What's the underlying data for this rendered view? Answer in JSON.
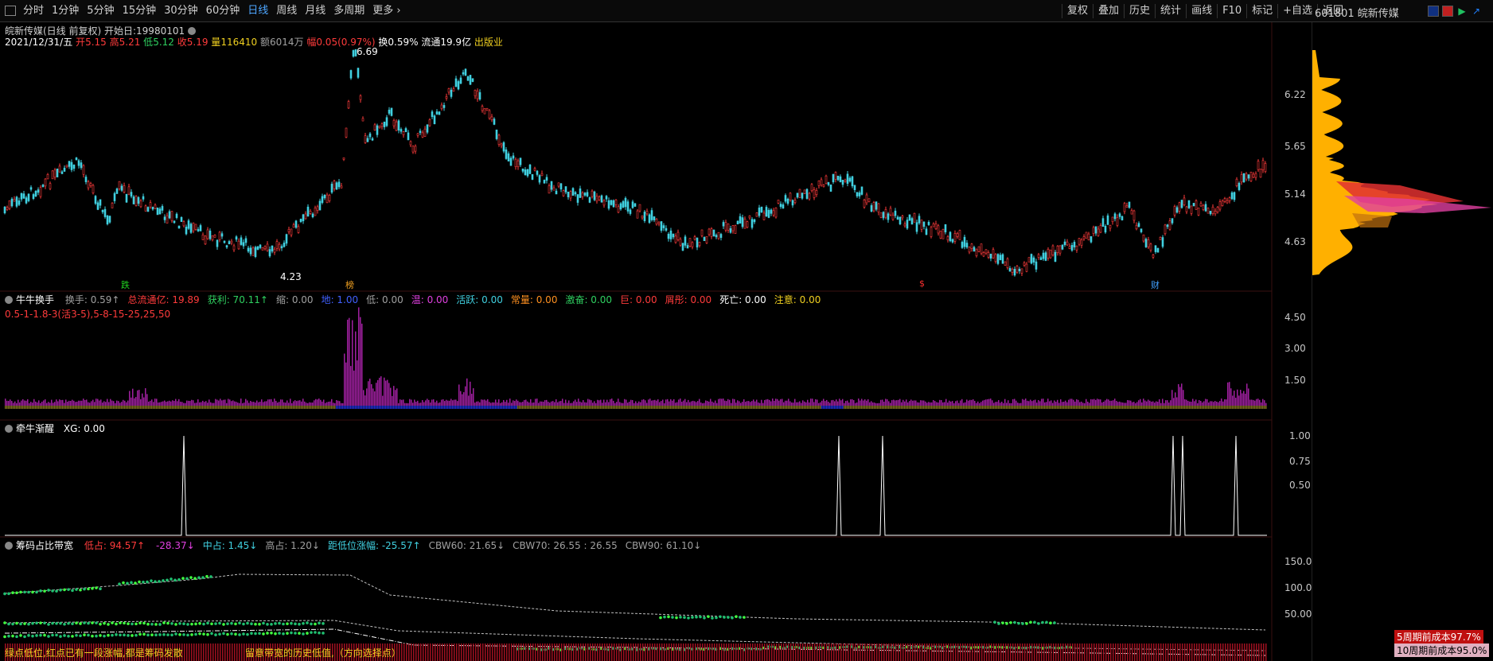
{
  "toolbar": {
    "periods": [
      "分时",
      "1分钟",
      "5分钟",
      "15分钟",
      "30分钟",
      "60分钟",
      "日线",
      "周线",
      "月线",
      "多周期",
      "更多"
    ],
    "active_period": "日线",
    "right_buttons": [
      "复权",
      "叠加",
      "历史",
      "统计",
      "画线",
      "F10",
      "标记",
      "+自选",
      "返回"
    ]
  },
  "symbol": {
    "code": "601801",
    "name": "皖新传媒"
  },
  "main_chart": {
    "title": "皖新传媒(日线 前复权) 开始日:19980101",
    "date": "2021/12/31/五",
    "open_label": "开",
    "open": "5.15",
    "high_label": "高",
    "high": "5.21",
    "low_label": "低",
    "low": "5.12",
    "close_label": "收",
    "close": "5.19",
    "vol_label": "量",
    "vol": "116410",
    "amount_label": "额",
    "amount": "6014万",
    "change_label": "幅",
    "change": "0.05(0.97%)",
    "turnover": "换0.59%",
    "float_cap": "流通19.9亿",
    "industry": "出版业",
    "y_ticks": [
      "6.22",
      "5.65",
      "5.14",
      "4.63"
    ],
    "high_marker": "6.69",
    "low_marker": "4.23",
    "markers": [
      "跌",
      "榜",
      "$",
      "财"
    ]
  },
  "panel2": {
    "title": "牛牛换手",
    "items": [
      {
        "label": "换手:",
        "value": "0.59",
        "arrow": "↑",
        "color": "gray"
      },
      {
        "label": "总流通亿:",
        "value": "19.89",
        "color": "red"
      },
      {
        "label": "获利:",
        "value": "70.11",
        "arrow": "↑",
        "color": "green"
      },
      {
        "label": "缩:",
        "value": "0.00",
        "color": "gray"
      },
      {
        "label": "地:",
        "value": "1.00",
        "color": "blue"
      },
      {
        "label": "低:",
        "value": "0.00",
        "color": "gray"
      },
      {
        "label": "温:",
        "value": "0.00",
        "color": "magenta"
      },
      {
        "label": "活跃:",
        "value": "0.00",
        "color": "cyan"
      },
      {
        "label": "常量:",
        "value": "0.00",
        "color": "orange"
      },
      {
        "label": "激奋:",
        "value": "0.00",
        "color": "green"
      },
      {
        "label": "巨:",
        "value": "0.00",
        "color": "red"
      },
      {
        "label": "屑彤:",
        "value": "0.00",
        "color": "red"
      },
      {
        "label": "死亡:",
        "value": "0.00",
        "color": "white"
      },
      {
        "label": "注意:",
        "value": "0.00",
        "color": "yellow"
      }
    ],
    "subtitle": "0.5-1-1.8-3(活3-5),5-8-15-25,25,50",
    "y_ticks": [
      "4.50",
      "3.00",
      "1.50"
    ]
  },
  "panel3": {
    "title": "牵牛渐醒",
    "xg": "XG: 0.00",
    "y_ticks": [
      "1.00",
      "0.75",
      "0.50"
    ]
  },
  "panel4": {
    "title": "筹码占比带宽",
    "items": [
      {
        "label": "低占:",
        "value": "94.57",
        "arrow": "↑",
        "color": "red"
      },
      {
        "label": "",
        "value": "-28.37",
        "arrow": "↓",
        "color": "magenta"
      },
      {
        "label": "中占:",
        "value": "1.45",
        "arrow": "↓",
        "color": "cyan"
      },
      {
        "label": "高占:",
        "value": "1.20",
        "arrow": "↓",
        "color": "gray"
      },
      {
        "label": "距低位涨幅:",
        "value": "-25.57",
        "arrow": "↑",
        "color": "cyan"
      },
      {
        "label": "CBW60:",
        "value": "21.65",
        "arrow": "↓",
        "color": "gray"
      },
      {
        "label": "CBW70:",
        "value": "26.55 : 26.55",
        "color": "gray"
      },
      {
        "label": "CBW90:",
        "value": "61.10",
        "arrow": "↓",
        "color": "gray"
      }
    ],
    "y_ticks": [
      "150.0",
      "100.0",
      "50.00"
    ],
    "bottom_text_left": "绿点低位,红点已有一段涨幅,都是筹码发散",
    "bottom_text_right": "留意带宽的历史低值,（方向选择点）"
  },
  "chip_panel": {
    "label_5": "5周期前成本97.7%",
    "label_10": "10周期前成本95.0%"
  },
  "colors": {
    "up": "#ff3b3b",
    "down": "#40d0e0",
    "chip": "#ffb000",
    "accent": "#4da6ff"
  }
}
